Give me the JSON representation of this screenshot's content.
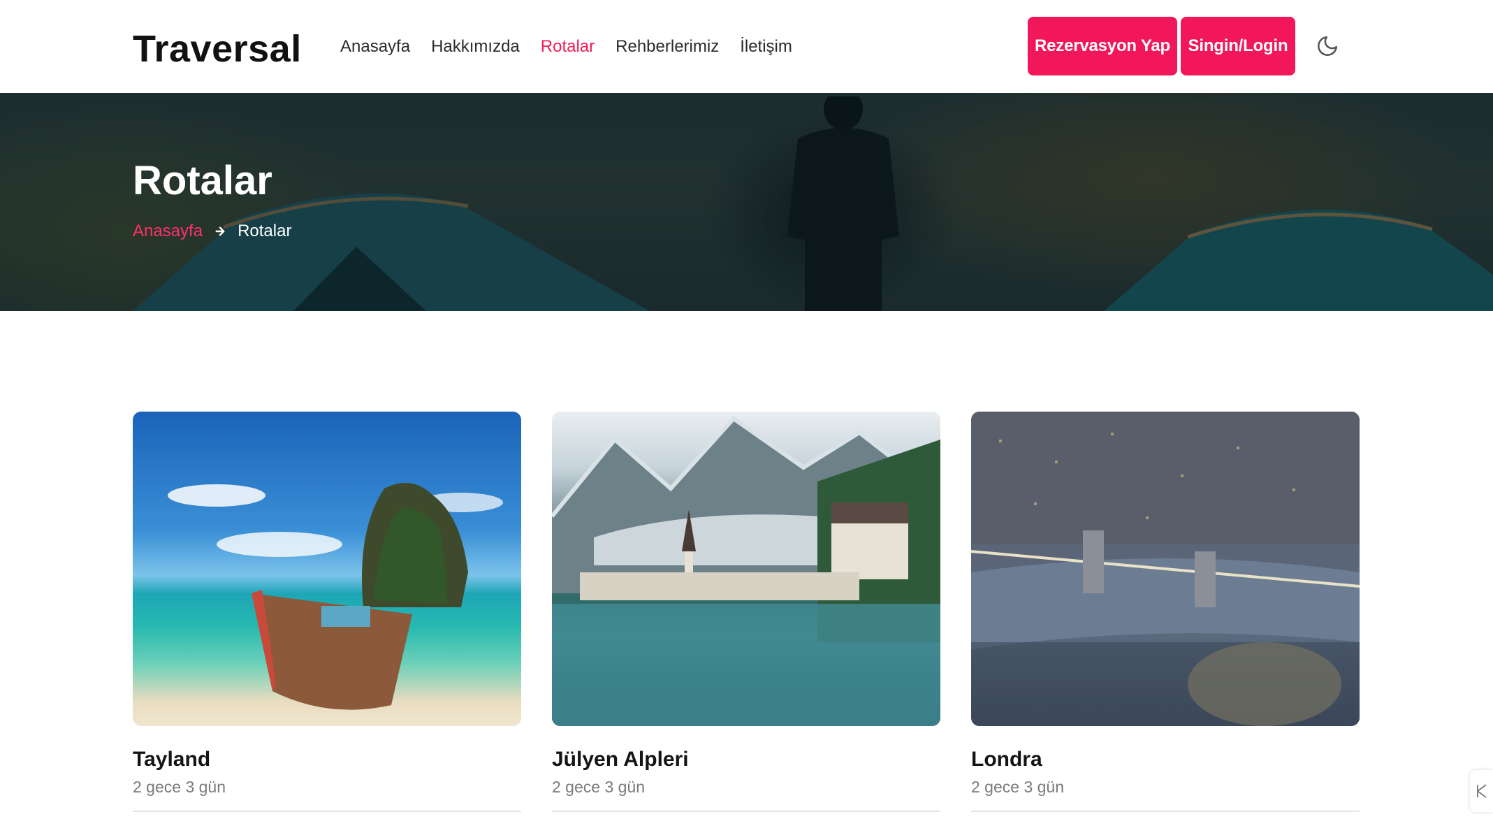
{
  "header": {
    "brand": "Traversal",
    "nav": [
      "Anasayfa",
      "Hakkımızda",
      "Rotalar",
      "Rehberlerimiz",
      "İletişim"
    ],
    "active_nav": "Rotalar",
    "book_button": "Rezervasyon Yap",
    "login_button": "Singin/Login",
    "theme_icon": "moon-icon"
  },
  "hero": {
    "title": "Rotalar",
    "breadcrumb_home": "Anasayfa",
    "breadcrumb_separator_icon": "arrow-right-icon",
    "breadcrumb_current": "Rotalar"
  },
  "cards": [
    {
      "title": "Tayland",
      "meta": "2 gece 3 gün"
    },
    {
      "title": "Jülyen Alpleri",
      "meta": "2 gece 3 gün"
    },
    {
      "title": "Londra",
      "meta": "2 gece 3 gün"
    }
  ],
  "colors": {
    "accent": "#f2165a",
    "active_link": "#ef1c56",
    "text": "#1d1d1f",
    "muted": "#7a7a7a"
  }
}
